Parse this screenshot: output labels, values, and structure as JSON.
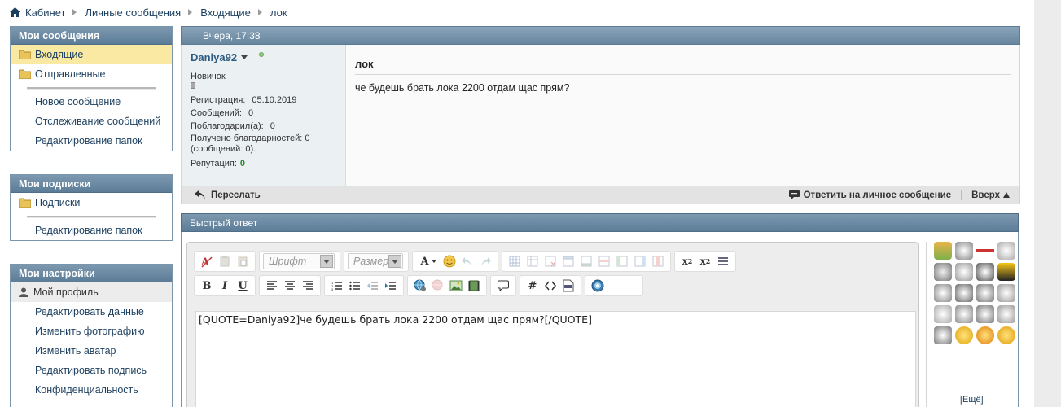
{
  "breadcrumb": {
    "items": [
      "Кабинет",
      "Личные сообщения",
      "Входящие"
    ],
    "current": "лок"
  },
  "sidebar": {
    "messages": {
      "title": "Мои сообщения",
      "folders": [
        {
          "label": "Входящие",
          "active": true
        },
        {
          "label": "Отправленные",
          "active": false
        }
      ],
      "links": [
        "Новое сообщение",
        "Отслеживание сообщений",
        "Редактирование папок"
      ]
    },
    "subscriptions": {
      "title": "Мои подписки",
      "folders": [
        {
          "label": "Подписки"
        }
      ],
      "links": [
        "Редактирование папок"
      ]
    },
    "settings": {
      "title": "Мои настройки",
      "profile": "Мой профиль",
      "links": [
        "Редактировать данные",
        "Изменить фотографию",
        "Изменить аватар",
        "Редактировать подпись",
        "Конфиденциальность"
      ]
    }
  },
  "message": {
    "date": "Вчера, 17:38",
    "user": {
      "name": "Daniya92",
      "rank": "Новичок",
      "reg_label": "Регистрация:",
      "reg_value": "05.10.2019",
      "posts_label": "Сообщений:",
      "posts_value": "0",
      "thanked_label": "Поблагодарил(а):",
      "thanked_value": "0",
      "received_line1": "Получено благодарностей: 0",
      "received_line2": "(сообщений: 0).",
      "rep_label": "Репутация:",
      "rep_value": "0"
    },
    "title": "лок",
    "text": "че будешь брать лока 2200 отдам щас прям?",
    "forward_label": "Переслать",
    "reply_label": "Ответить на личное сообщение",
    "top_label": "Вверх"
  },
  "quick_reply": {
    "title": "Быстрый ответ",
    "font_placeholder": "Шрифт",
    "size_placeholder": "Размер",
    "editor_text": "[QUOTE=Daniya92]че будешь брать лока 2200 отдам щас прям?[/QUOTE]",
    "more_label": "[Ещё]"
  },
  "colors": {
    "header_blue": "#6b89a2",
    "link": "#1c3f5f",
    "active_folder": "#f9e9a3",
    "reputation": "#2a8a2a"
  }
}
